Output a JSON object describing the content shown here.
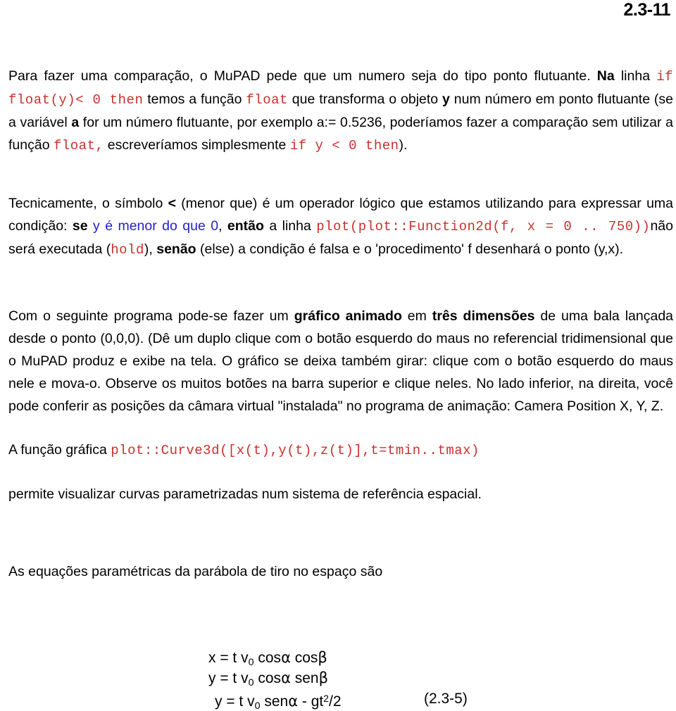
{
  "header": {
    "page_number": "2.3-11"
  },
  "paragraphs": {
    "p1": {
      "seg1": "Para fazer uma comparação, o MuPAD pede que um numero seja do tipo ponto flutuante. ",
      "seg2_bold": "Na",
      "seg3": " linha ",
      "code1": "if float(y)< 0 then",
      "seg4": " temos a função ",
      "code2": "float",
      "seg5": " que transforma o objeto ",
      "bold_y": "y",
      "seg6": " num número em ponto flutuante (se a variável ",
      "bold_a": "a",
      "seg7": " for um número flutuante, por exemplo a:= 0.5236, poderíamos fazer a comparação sem utilizar a função ",
      "code3": "float,",
      "seg8": " escreveríamos simplesmente ",
      "code4": "if y < 0 then",
      "seg9": ")."
    },
    "p2": {
      "seg1": "Tecnicamente, o símbolo ",
      "bold_lt": "<",
      "seg2": " (menor que) é um operador lógico que estamos utilizando para expressar uma condição: ",
      "bold_se": "se",
      "blue1": " y é menor do que 0",
      "seg3": ", ",
      "bold_entao": "então",
      "seg4": " a linha ",
      "code1": "plot(plot::Function2d(f, x = 0 .. 750))",
      "seg5": "não será executada (",
      "code2": "hold",
      "seg6": "), ",
      "bold_senao": "senão",
      "seg7": " (else) a condição é falsa e o 'procedimento' f desenhará o ponto (y,x)."
    },
    "p3": {
      "seg1": "Com o seguinte programa pode-se fazer um ",
      "bold1": "gráfico animado",
      "seg2": " em ",
      "bold2": "três dimensões",
      "seg3": " de uma bala lançada desde o ponto (0,0,0). (Dê um duplo clique com o botão esquerdo do maus no referencial tridimensional que o MuPAD produz e exibe na tela. O gráfico se deixa também girar: clique com o botão esquerdo do maus nele e mova-o. Observe os muitos botões na barra superior e clique neles. No lado inferior, na direita, você pode conferir as posições da câmara virtual \"instalada\" no programa de animação: Camera Position X, Y, Z."
    },
    "p4": {
      "seg1": "A função gráfica ",
      "code1": "plot::Curve3d([x(t),y(t),z(t)],t=tmin..tmax)"
    },
    "p5": {
      "seg1": "permite visualizar curvas parametrizadas num sistema de referência espacial."
    },
    "p6": {
      "seg1": "As equações paramétricas da parábola de tiro no espaço são"
    }
  },
  "equations": {
    "eq1": {
      "lhs": "x = t v",
      "sub": "0",
      "rhs": " cos",
      "alpha": "α",
      "rhs2": " cos",
      "beta": "β"
    },
    "eq2": {
      "lhs": "y = t v",
      "sub": "0",
      "rhs": " cos",
      "alpha": "α",
      "rhs2": " sen",
      "beta": "β"
    },
    "eq3": {
      "lhs": "y = t v",
      "sub": "0",
      "rhs": " sen",
      "alpha": "α",
      "rhs2": " - gt",
      "sup": "2",
      "rhs3": "/2"
    },
    "tag": "(2.3-5)"
  },
  "colors": {
    "code_red": "#c9302c",
    "highlight_blue": "#2222cc",
    "text_black": "#000000",
    "page_background": "#ffffff"
  }
}
